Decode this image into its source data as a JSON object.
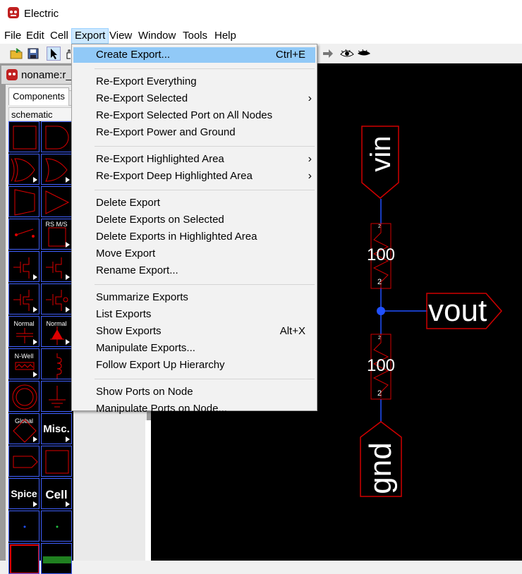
{
  "window": {
    "title": "Electric"
  },
  "menubar": {
    "items": [
      "File",
      "Edit",
      "Cell",
      "Export",
      "View",
      "Window",
      "Tools",
      "Help"
    ],
    "active": "Export"
  },
  "document": {
    "title": "noname:r_c"
  },
  "side_panel": {
    "tab": "Components",
    "palette": "schematic"
  },
  "palette_labels": {
    "rs": "RS M/S",
    "normal1": "Normal",
    "normal2": "Normal",
    "nwell": "N-Well",
    "global": "Global",
    "misc": "Misc.",
    "spice": "Spice",
    "cell": "Cell"
  },
  "export_menu": {
    "groups": [
      [
        {
          "label": "Create Export...",
          "accel": "Ctrl+E",
          "submenu": false
        }
      ],
      [
        {
          "label": "Re-Export Everything",
          "accel": "",
          "submenu": false
        },
        {
          "label": "Re-Export Selected",
          "accel": "",
          "submenu": true
        },
        {
          "label": "Re-Export Selected Port on All Nodes",
          "accel": "",
          "submenu": false
        },
        {
          "label": "Re-Export Power and Ground",
          "accel": "",
          "submenu": false
        }
      ],
      [
        {
          "label": "Re-Export Highlighted Area",
          "accel": "",
          "submenu": true
        },
        {
          "label": "Re-Export Deep Highlighted Area",
          "accel": "",
          "submenu": true
        }
      ],
      [
        {
          "label": "Delete Export",
          "accel": "",
          "submenu": false
        },
        {
          "label": "Delete Exports on Selected",
          "accel": "",
          "submenu": false
        },
        {
          "label": "Delete Exports in Highlighted Area",
          "accel": "",
          "submenu": false
        },
        {
          "label": "Move Export",
          "accel": "",
          "submenu": false
        },
        {
          "label": "Rename Export...",
          "accel": "",
          "submenu": false
        }
      ],
      [
        {
          "label": "Summarize Exports",
          "accel": "",
          "submenu": false
        },
        {
          "label": "List Exports",
          "accel": "",
          "submenu": false
        },
        {
          "label": "Show Exports",
          "accel": "Alt+X",
          "submenu": false
        },
        {
          "label": "Manipulate Exports...",
          "accel": "",
          "submenu": false
        },
        {
          "label": "Follow Export Up Hierarchy",
          "accel": "",
          "submenu": false
        }
      ],
      [
        {
          "label": "Show Ports on Node",
          "accel": "",
          "submenu": false
        },
        {
          "label": "Manipulate Ports on Node...",
          "accel": "",
          "submenu": false
        }
      ]
    ]
  },
  "schematic": {
    "exports": {
      "top": "vin",
      "right": "vout",
      "bottom": "gnd"
    },
    "resistors": [
      {
        "value": "100",
        "pin_top": "2",
        "pin_bottom": "2"
      },
      {
        "value": "100",
        "pin_top": "2",
        "pin_bottom": "2"
      }
    ]
  },
  "colors": {
    "menu_selected": "#91c9f7",
    "wire": "#2050ff",
    "node_outline": "#d00000"
  }
}
